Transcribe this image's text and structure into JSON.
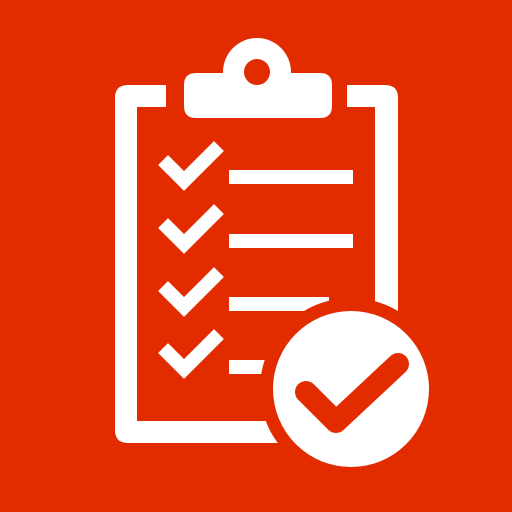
{
  "icon": {
    "name": "clipboard-checklist-approved-icon",
    "background_color": "#e32b00",
    "foreground_color": "#ffffff",
    "checklist_item_count": 4,
    "badge_icon": "check-circle-icon"
  }
}
